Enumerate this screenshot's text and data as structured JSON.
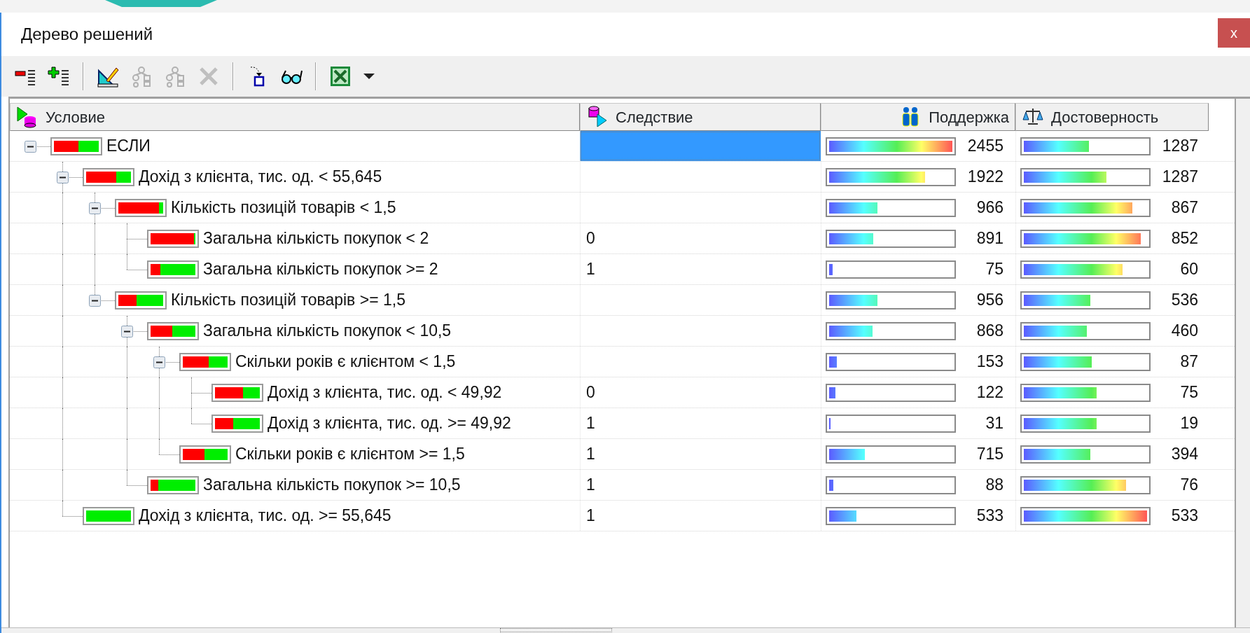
{
  "window": {
    "title": "Дерево решений",
    "close_label": "x"
  },
  "toolbar": [
    {
      "kind": "collapse-all",
      "disabled": false
    },
    {
      "kind": "expand-all",
      "disabled": false
    },
    {
      "kind": "separator"
    },
    {
      "kind": "edit",
      "disabled": false
    },
    {
      "kind": "tree-a",
      "disabled": true
    },
    {
      "kind": "tree-b",
      "disabled": true
    },
    {
      "kind": "delete",
      "disabled": true
    },
    {
      "kind": "separator"
    },
    {
      "kind": "move",
      "disabled": false
    },
    {
      "kind": "view",
      "disabled": false
    },
    {
      "kind": "separator"
    },
    {
      "kind": "excel",
      "disabled": false
    },
    {
      "kind": "dropdown",
      "disabled": false
    }
  ],
  "tree": {
    "columns": [
      "Условие",
      "Следствие",
      "Поддержка",
      "Достоверность"
    ],
    "rows": [
      {
        "label": "ЕСЛИ",
        "expanded": true,
        "selected": true,
        "class_bar": {
          "level": 0.46
        },
        "support": {
          "level": 1.0,
          "value": "2455"
        },
        "confidence": {
          "level": 0.53,
          "value": "1287"
        },
        "children": [
          {
            "label": "Дохід з клієнта, тис. од. < 55,645",
            "expanded": true,
            "selected": false,
            "class_bar": {
              "level": 0.33
            },
            "support": {
              "level": 0.78,
              "value": "1922"
            },
            "confidence": {
              "level": 0.67,
              "value": "1287"
            },
            "children": [
              {
                "label": "Кількість позицій товарів < 1,5",
                "expanded": true,
                "selected": false,
                "class_bar": {
                  "level": 0.1
                },
                "support": {
                  "level": 0.39,
                  "value": "966"
                },
                "confidence": {
                  "level": 0.88,
                  "value": "867"
                },
                "children": [
                  {
                    "label": "Загальна кількість покупок < 2",
                    "consequence": "0",
                    "selected": false,
                    "class_bar": {
                      "level": 0.03
                    },
                    "support": {
                      "level": 0.36,
                      "value": "891"
                    },
                    "confidence": {
                      "level": 0.95,
                      "value": "852"
                    }
                  },
                  {
                    "label": "Загальна кількість покупок >= 2",
                    "consequence": "1",
                    "selected": false,
                    "class_bar": {
                      "level": 0.78
                    },
                    "support": {
                      "level": 0.03,
                      "value": "75"
                    },
                    "confidence": {
                      "level": 0.8,
                      "value": "60"
                    }
                  }
                ]
              },
              {
                "label": "Кількість позицій товарів >= 1,5",
                "expanded": true,
                "selected": false,
                "class_bar": {
                  "level": 0.6
                },
                "support": {
                  "level": 0.39,
                  "value": "956"
                },
                "confidence": {
                  "level": 0.54,
                  "value": "536"
                },
                "children": [
                  {
                    "label": "Загальна кількість покупок < 10,5",
                    "expanded": true,
                    "selected": false,
                    "class_bar": {
                      "level": 0.52
                    },
                    "support": {
                      "level": 0.35,
                      "value": "868"
                    },
                    "confidence": {
                      "level": 0.51,
                      "value": "460"
                    },
                    "children": [
                      {
                        "label": "Скільки років є клієнтом < 1,5",
                        "expanded": true,
                        "selected": false,
                        "class_bar": {
                          "level": 0.42
                        },
                        "support": {
                          "level": 0.06,
                          "value": "153"
                        },
                        "confidence": {
                          "level": 0.55,
                          "value": "87"
                        },
                        "children": [
                          {
                            "label": "Дохід з клієнта, тис. од. < 49,92",
                            "consequence": "0",
                            "selected": false,
                            "class_bar": {
                              "level": 0.38
                            },
                            "support": {
                              "level": 0.05,
                              "value": "122"
                            },
                            "confidence": {
                              "level": 0.59,
                              "value": "75"
                            }
                          },
                          {
                            "label": "Дохід з клієнта, тис. од. >= 49,92",
                            "consequence": "1",
                            "selected": false,
                            "class_bar": {
                              "level": 0.6
                            },
                            "support": {
                              "level": 0.013,
                              "value": "31"
                            },
                            "confidence": {
                              "level": 0.59,
                              "value": "19"
                            }
                          }
                        ]
                      },
                      {
                        "label": "Скільки років є клієнтом >= 1,5",
                        "consequence": "1",
                        "selected": false,
                        "class_bar": {
                          "level": 0.52
                        },
                        "support": {
                          "level": 0.29,
                          "value": "715"
                        },
                        "confidence": {
                          "level": 0.54,
                          "value": "394"
                        }
                      }
                    ]
                  },
                  {
                    "label": "Загальна кількість покупок >= 10,5",
                    "consequence": "1",
                    "selected": false,
                    "class_bar": {
                      "level": 0.83
                    },
                    "support": {
                      "level": 0.036,
                      "value": "88"
                    },
                    "confidence": {
                      "level": 0.83,
                      "value": "76"
                    }
                  }
                ]
              }
            ]
          },
          {
            "label": "Дохід з клієнта, тис. од. >= 55,645",
            "consequence": "1",
            "selected": false,
            "class_bar": {
              "level": 1.0
            },
            "support": {
              "level": 0.22,
              "value": "533"
            },
            "confidence": {
              "level": 1.0,
              "value": "533"
            }
          }
        ]
      }
    ]
  }
}
